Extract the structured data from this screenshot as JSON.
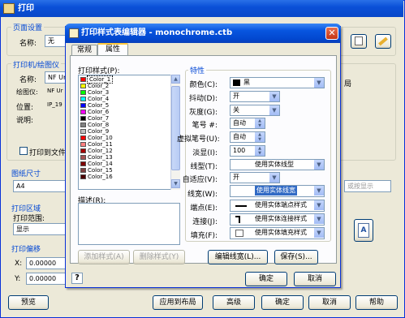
{
  "outer": {
    "title": "打印",
    "page_setup_title": "页面设置",
    "name_label": "名称:",
    "name_value": "无",
    "printer_title": "打印机/绘图仪",
    "printer_name_label": "名称:",
    "printer_name_value": "NF Ur",
    "plotter_label": "绘图仪:",
    "plotter_value": "NF Ur",
    "location_label": "位置:",
    "location_value": "IP_19",
    "desc_label": "说明:",
    "print_to_file_label": "打印到文件",
    "paper_size_title": "图纸尺寸",
    "paper_size_value": "A4",
    "print_area_title": "打印区域",
    "print_range_label": "打印范围:",
    "print_range_value": "显示",
    "print_offset_title": "打印偏移",
    "x_label": "X:",
    "x_value": "0.00000",
    "y_label": "Y:",
    "y_value": "0.00000",
    "right_fragment_1": "局",
    "right_fragment_2": "或按显示",
    "preview_button": "预览",
    "apply_layout_button": "应用到布局",
    "advanced_button": "高级",
    "ok_button": "确定",
    "cancel_button": "取消",
    "help_button": "帮助"
  },
  "dialog": {
    "title": "打印样式表编辑器 - monochrome.ctb",
    "tabs": [
      "常规",
      "属性"
    ],
    "active_tab": "属性",
    "styles_label": "打印样式(P):",
    "styles": [
      {
        "name": "Color_1",
        "color": "#ff0000",
        "selected": true
      },
      {
        "name": "Color_2",
        "color": "#ffff00"
      },
      {
        "name": "Color_3",
        "color": "#00ff00"
      },
      {
        "name": "Color_4",
        "color": "#00ffff"
      },
      {
        "name": "Color_5",
        "color": "#0000ff"
      },
      {
        "name": "Color_6",
        "color": "#ff00ff"
      },
      {
        "name": "Color_7",
        "color": "#000000"
      },
      {
        "name": "Color_8",
        "color": "#808080"
      },
      {
        "name": "Color_9",
        "color": "#c0c0c0"
      },
      {
        "name": "Color_10",
        "color": "#ff0000"
      },
      {
        "name": "Color_11",
        "color": "#ff7f7f"
      },
      {
        "name": "Color_12",
        "color": "#a50000"
      },
      {
        "name": "Color_13",
        "color": "#a55252"
      },
      {
        "name": "Color_14",
        "color": "#7f0000"
      },
      {
        "name": "Color_15",
        "color": "#7f3f3f"
      },
      {
        "name": "Color_16",
        "color": "#4c0000"
      }
    ],
    "desc_label": "描述(R):",
    "add_style_button": "添加样式(A)",
    "delete_style_button": "删除样式(Y)",
    "edit_lineweight_button": "编辑线宽(L)...",
    "save_button": "保存(S)...",
    "ok_button": "确定",
    "cancel_button": "取消",
    "help_glyph": "?",
    "properties_title": "特性",
    "props": {
      "color": {
        "label": "颜色(C):",
        "value": "黑",
        "swatch": "#000000"
      },
      "dither": {
        "label": "抖动(D):",
        "value": "开"
      },
      "grayscale": {
        "label": "灰度(G):",
        "value": "关"
      },
      "pen": {
        "label": "笔号 #:",
        "value": "自动"
      },
      "virtual_pen": {
        "label": "虚拟笔号(U):",
        "value": "自动"
      },
      "screening": {
        "label": "淡显(I):",
        "value": "100"
      },
      "linetype": {
        "label": "线型(T):",
        "value": "使用实体线型"
      },
      "adaptive": {
        "label": "自适应(V):",
        "value": "开"
      },
      "lineweight": {
        "label": "线宽(W):",
        "value": "使用实体线宽"
      },
      "line_end": {
        "label": "端点(E):",
        "value": "使用实体端点样式"
      },
      "line_join": {
        "label": "连接(J):",
        "value": "使用实体连接样式"
      },
      "fill": {
        "label": "填充(F):",
        "value": "使用实体填充样式"
      }
    }
  }
}
